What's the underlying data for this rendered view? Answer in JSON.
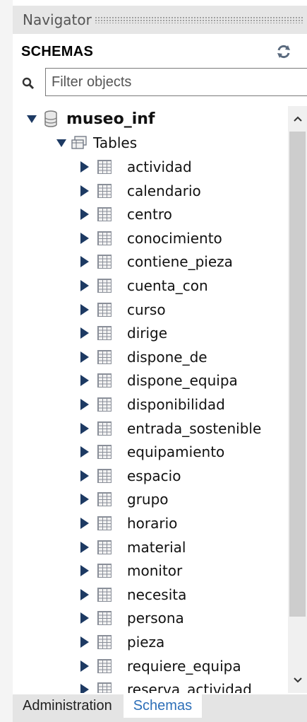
{
  "navigator": {
    "title": "Navigator"
  },
  "schemas_section": {
    "label": "SCHEMAS"
  },
  "filter": {
    "placeholder": "Filter objects",
    "value": ""
  },
  "tree": {
    "schema_name": "museo_inf",
    "tables_label": "Tables",
    "tables": [
      "actividad",
      "calendario",
      "centro",
      "conocimiento",
      "contiene_pieza",
      "cuenta_con",
      "curso",
      "dirige",
      "dispone_de",
      "dispone_equipa",
      "disponibilidad",
      "entrada_sostenible",
      "equipamiento",
      "espacio",
      "grupo",
      "horario",
      "material",
      "monitor",
      "necesita",
      "persona",
      "pieza",
      "requiere_equipa",
      "reserva_actividad"
    ]
  },
  "bottom_tabs": {
    "administration": "Administration",
    "schemas": "Schemas"
  },
  "colors": {
    "accent": "#2d6fb8",
    "tree_arrow": "#1d3a63"
  }
}
